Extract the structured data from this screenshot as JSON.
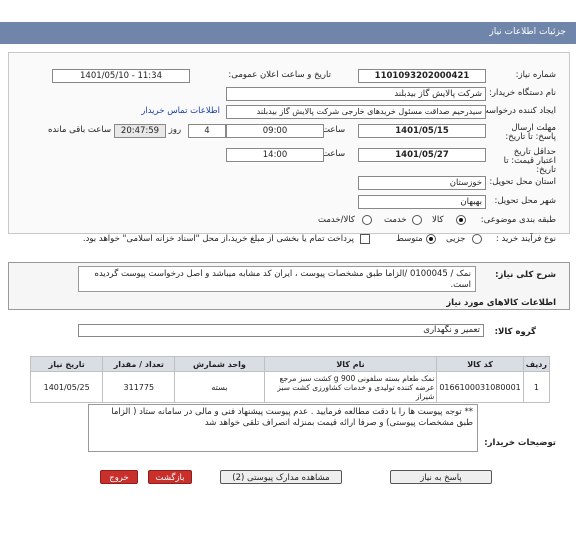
{
  "header": {
    "title": "جزئیات اطلاعات نیاز"
  },
  "form": {
    "need_number_label": "شماره نیاز:",
    "need_number": "1101093202000421",
    "announce_label": "تاریخ و ساعت اعلان عمومی:",
    "announce_value": "1401/05/10 - 11:34",
    "buyer_org_label": "نام دستگاه خریدار:",
    "buyer_org": "شرکت پالایش گاز بیدبلند",
    "creator_label": "ایجاد کننده درخواست:",
    "creator": "سیدرحیم صداقت مسئول خریدهای خارجی شرکت پالایش گاز بیدبلند",
    "contact_link": "اطلاعات تماس خریدار",
    "send_deadline_label": "مهلت ارسال پاسخ: تا تاریخ:",
    "send_deadline_date": "1401/05/15",
    "time_label": "ساعت",
    "send_deadline_time": "09:00",
    "days_value": "4",
    "days_label": "روز و",
    "remaining_time": "20:47:59",
    "remaining_label": "ساعت باقی مانده",
    "validity_label": "حداقل تاریخ اعتبار قیمت: تا تاریخ:",
    "validity_date": "1401/05/27",
    "validity_time_label": "ساعت",
    "validity_time": "14:00",
    "province_label": "استان محل تحویل:",
    "province": "خوزستان",
    "city_label": "شهر محل تحویل:",
    "city": "بهبهان",
    "category_label": "طبقه بندی موضوعی:",
    "category_options": [
      "کالا",
      "خدمت",
      "کالا/خدمت"
    ],
    "category_selected": "کالا",
    "process_label": "نوع فرآیند خرید :",
    "process_options": [
      "جزیی",
      "متوسط"
    ],
    "process_selected": "متوسط",
    "payment_note": "پرداخت تمام یا بخشی از مبلغ خرید،از محل \"اسناد خزانه اسلامی\" خواهد بود."
  },
  "description": {
    "label": "شرح کلی نیاز:",
    "text": "نمک / 0100045 /الزاما طبق مشخصات پیوست ، ایران کد مشابه میباشد و اصل درخواست پیوست گردیده است."
  },
  "goods": {
    "section_title": "اطلاعات کالاهای مورد نیاز",
    "group_label": "گروه کالا:",
    "group_value": "تعمیر و نگهداری",
    "columns": [
      "ردیف",
      "کد کالا",
      "نام کالا",
      "واحد شمارش",
      "تعداد / مقدار",
      "تاریخ نیاز"
    ],
    "rows": [
      {
        "row": "1",
        "code": "0166100031080001",
        "name": "نمک طعام بسته سلفونی 900 g کشت سبز مرجع عرضه کننده تولیدی و خدمات کشاورزی کشت سبز شیراز",
        "unit": "بسته",
        "qty": "311775",
        "date": "1401/05/25"
      }
    ]
  },
  "buyer_notes": {
    "label": "توضیحات خریدار:",
    "text": "** توجه پیوست ها را با دقت مطالعه فرمایید . عدم پیوست پیشنهاد فنی و مالی در سامانه ستاد ( الزاما طبق مشخصات پیوستی) و صرفا ارائه قیمت بمنزله انصراف تلقی خواهد شد"
  },
  "buttons": {
    "reply": "پاسخ به نیاز",
    "attachments": "مشاهده مدارک پیوستی (2)",
    "back": "بازگشت",
    "exit": "خروج"
  },
  "colors": {
    "header": "#6f86aa",
    "danger": "#c9302c",
    "link": "#1a3da8"
  }
}
